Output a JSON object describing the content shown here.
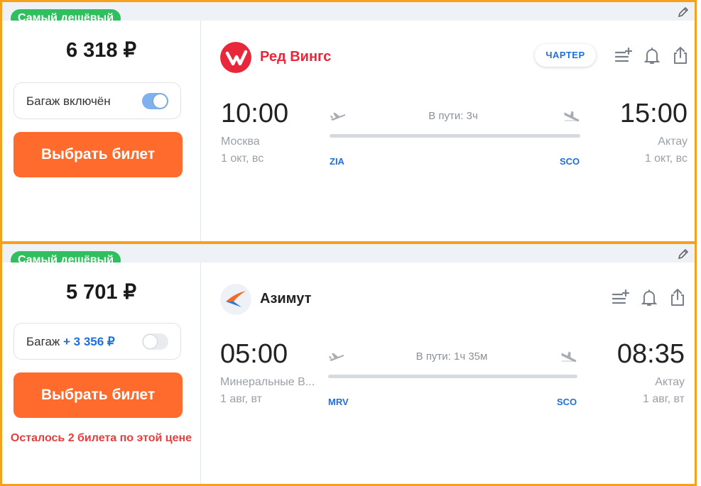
{
  "colors": {
    "accent": "#f7a01c",
    "button": "#ff6b2c",
    "badge": "#2fbf5f",
    "link": "#1e6fe0",
    "warning": "#e53e3e"
  },
  "tickets": [
    {
      "badge": "Самый дешёвый",
      "price": "6 318 ₽",
      "baggage": {
        "label": "Багаж включён",
        "extra": "",
        "toggle_on": true
      },
      "button": "Выбрать билет",
      "warning": "",
      "airline": {
        "name": "Ред Вингс",
        "logo": "red-wings-logo",
        "color": "#e8273b"
      },
      "charter_badge": "ЧАРТЕР",
      "departure": {
        "time": "10:00",
        "city": "Москва",
        "date": "1 окт, вс",
        "airport": "ZIA"
      },
      "arrival": {
        "time": "15:00",
        "city": "Актау",
        "date": "1 окт, вс",
        "airport": "SCO"
      },
      "duration": "В пути: 3ч",
      "icons": [
        "add-to-list-icon",
        "bell-icon",
        "share-icon",
        "pencil-icon"
      ]
    },
    {
      "badge": "Самый дешёвый",
      "price": "5 701 ₽",
      "baggage": {
        "label": "Багаж",
        "extra": "+ 3 356 ₽",
        "toggle_on": false
      },
      "button": "Выбрать билет",
      "warning": "Осталось 2 билета по этой цене",
      "airline": {
        "name": "Азимут",
        "logo": "azimuth-logo",
        "color": "#222222"
      },
      "charter_badge": "",
      "departure": {
        "time": "05:00",
        "city": "Минеральные В...",
        "date": "1 авг, вт",
        "airport": "MRV"
      },
      "arrival": {
        "time": "08:35",
        "city": "Актау",
        "date": "1 авг, вт",
        "airport": "SCO"
      },
      "duration": "В пути: 1ч 35м",
      "icons": [
        "add-to-list-icon",
        "bell-icon",
        "share-icon",
        "pencil-icon"
      ]
    }
  ]
}
